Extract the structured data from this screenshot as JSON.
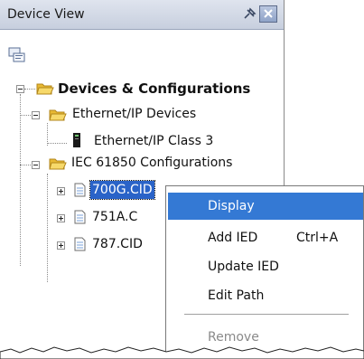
{
  "panel": {
    "title": "Device View",
    "pin_icon": "pin-icon",
    "close_icon": "close-icon",
    "toolbar_icon": "device-tree-icon"
  },
  "tree": {
    "root": {
      "label": "Devices & Configurations",
      "expanded": true
    },
    "ethernet_ip": {
      "label": "Ethernet/IP Devices",
      "expanded": true
    },
    "ethernet_ip_class3": {
      "label": "Ethernet/IP Class 3"
    },
    "iec": {
      "label": "IEC 61850 Configurations",
      "expanded": true
    },
    "cid_items": [
      {
        "label": "700G.CID",
        "selected": true
      },
      {
        "label": "751A.C"
      },
      {
        "label": "787.CID"
      }
    ]
  },
  "context_menu": {
    "items": [
      {
        "label": "Display",
        "highlighted": true
      },
      {
        "label": "Add IED",
        "shortcut": "Ctrl+A"
      },
      {
        "label": "Update IED"
      },
      {
        "label": "Edit Path"
      },
      {
        "label": "Remove",
        "disabled": true
      }
    ]
  },
  "colors": {
    "selection": "#2a63c8",
    "menu_highlight": "#3479d4",
    "folder": "#f2c94c"
  }
}
